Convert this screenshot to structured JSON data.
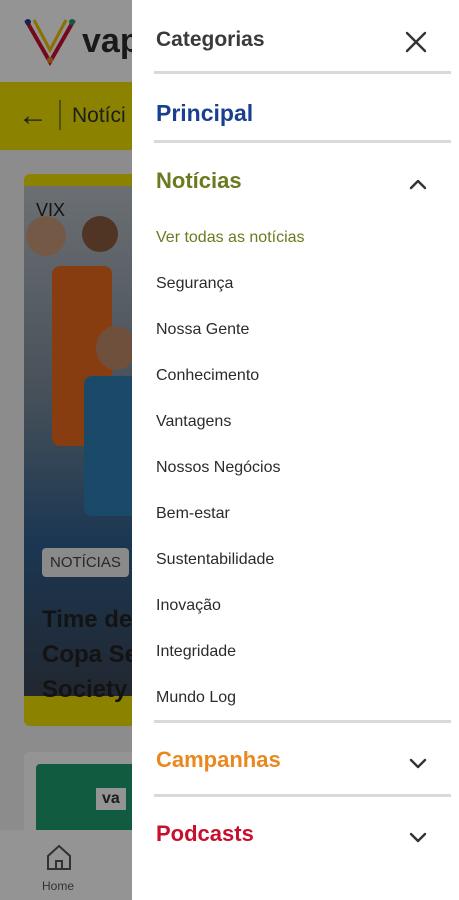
{
  "background": {
    "brand": "vap",
    "section_title": "Notíci",
    "card_chip": "NOTÍCIAS",
    "card_photo_text": "VIX",
    "card_title": "Time de\nCopa Se\nSociety",
    "card2_logo_text": "va",
    "tab_home_label": "Home"
  },
  "drawer": {
    "title": "Categorias",
    "principal_label": "Principal",
    "sections": {
      "noticias": {
        "label": "Notícias",
        "items": [
          "Ver todas as notícias",
          "Segurança",
          "Nossa Gente",
          "Conhecimento",
          "Vantagens",
          "Nossos Negócios",
          "Bem-estar",
          "Sustentabilidade",
          "Inovação",
          "Integridade",
          "Mundo Log"
        ]
      },
      "campanhas": {
        "label": "Campanhas"
      },
      "podcasts": {
        "label": "Podcasts"
      }
    }
  },
  "colors": {
    "principal": "#1a3f8f",
    "noticias": "#6b7a1f",
    "campanhas": "#e8881e",
    "podcasts": "#c8102e",
    "accent_yellow": "#f0e100"
  },
  "icons": {
    "close": "close-icon",
    "back": "arrow-left-icon",
    "expanded": "chevron-up-icon",
    "collapsed": "chevron-down-icon",
    "home": "home-icon"
  }
}
